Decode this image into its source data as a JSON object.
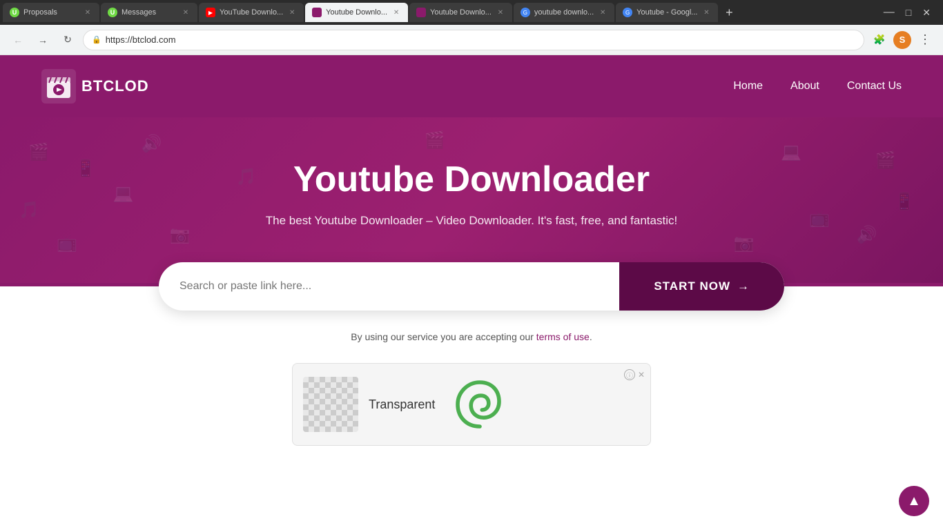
{
  "browser": {
    "url": "https://btclod.com",
    "tabs": [
      {
        "id": "proposals",
        "label": "Proposals",
        "favicon_type": "upwork",
        "active": false
      },
      {
        "id": "messages",
        "label": "Messages",
        "favicon_type": "upwork",
        "active": false
      },
      {
        "id": "youtube-dl-1",
        "label": "YouTube Downlo...",
        "favicon_type": "youtube",
        "active": false
      },
      {
        "id": "youtube-dl-2",
        "label": "Youtube Downlo...",
        "favicon_type": "btclod",
        "active": true
      },
      {
        "id": "youtube-dl-3",
        "label": "Youtube Downlo...",
        "favicon_type": "btclod",
        "active": false
      },
      {
        "id": "youtube-dl-4",
        "label": "youtube downlo...",
        "favicon_type": "google",
        "active": false
      },
      {
        "id": "youtube-google",
        "label": "Youtube - Googl...",
        "favicon_type": "google",
        "active": false
      }
    ],
    "profile_initial": "S"
  },
  "header": {
    "logo_text": "BTCLOD",
    "nav": [
      {
        "label": "Home",
        "id": "home"
      },
      {
        "label": "About",
        "id": "about"
      },
      {
        "label": "Contact Us",
        "id": "contact"
      }
    ]
  },
  "hero": {
    "title": "Youtube Downloader",
    "subtitle": "The best Youtube Downloader – Video Downloader. It's fast, free, and fantastic!"
  },
  "search": {
    "placeholder": "Search or paste link here...",
    "button_label": "START NOW",
    "button_arrow": "→"
  },
  "terms": {
    "text": "By using our service you are accepting our",
    "link_text": "terms of use",
    "period": "."
  },
  "ad": {
    "text": "Transparent"
  },
  "icons": {
    "lock": "🔒",
    "back": "←",
    "forward": "→",
    "refresh": "↻",
    "puzzle": "🧩",
    "menu": "⋮",
    "new_tab": "+",
    "minimize": "—",
    "maximize": "□",
    "close": "✕",
    "scroll_top": "▲",
    "info": "ⓘ",
    "ad_close": "✕"
  },
  "colors": {
    "brand_purple": "#8B1A6B",
    "brand_dark": "#5c0a47",
    "upwork_green": "#6FDA44",
    "youtube_red": "#FF0000"
  }
}
